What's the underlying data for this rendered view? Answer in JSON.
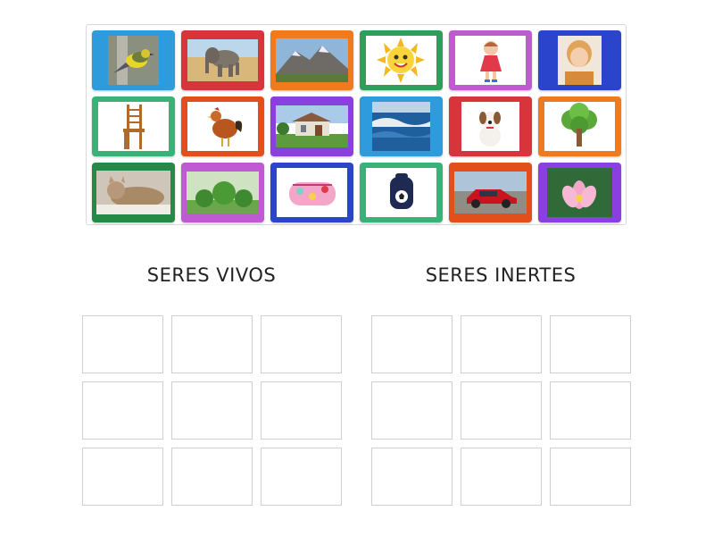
{
  "groups": {
    "left_label": "SERES VIVOS",
    "right_label": "SERES INERTES"
  },
  "cards": [
    {
      "subject": "bird",
      "color": "#2d9bdc"
    },
    {
      "subject": "elephant",
      "color": "#d8343c"
    },
    {
      "subject": "mountain",
      "color": "#f07a1e"
    },
    {
      "subject": "sun",
      "color": "#2e9e5a"
    },
    {
      "subject": "doll",
      "color": "#c05ad2"
    },
    {
      "subject": "child",
      "color": "#2b44cc"
    },
    {
      "subject": "chair",
      "color": "#39b27a"
    },
    {
      "subject": "rooster",
      "color": "#e24f1a"
    },
    {
      "subject": "house",
      "color": "#8b3fe0"
    },
    {
      "subject": "sea",
      "color": "#2d9bdc"
    },
    {
      "subject": "dog",
      "color": "#d8343c"
    },
    {
      "subject": "tree",
      "color": "#f07a1e"
    },
    {
      "subject": "cat",
      "color": "#258a48"
    },
    {
      "subject": "bushes",
      "color": "#c05ad2"
    },
    {
      "subject": "pencil-case",
      "color": "#2b44cc"
    },
    {
      "subject": "backpack",
      "color": "#39b27a"
    },
    {
      "subject": "car",
      "color": "#e24f1a"
    },
    {
      "subject": "lotus-flower",
      "color": "#8b3fe0"
    }
  ]
}
